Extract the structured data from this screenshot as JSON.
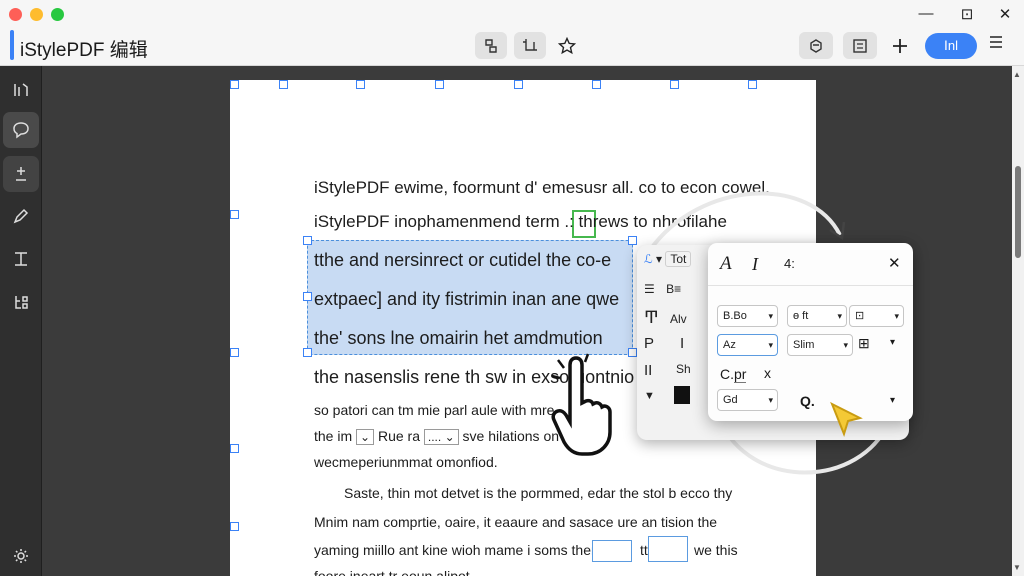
{
  "app": {
    "title": "iStylePDF 编辑"
  },
  "titlebar": {
    "window_controls": {
      "minimize": "—",
      "restore": "⊡",
      "close": "✕"
    },
    "center_buttons": [
      "page-layout-icon",
      "crop-icon",
      "star-icon"
    ],
    "right_buttons": [
      "plugin-icon",
      "page-grid-icon",
      "plus-icon"
    ],
    "primary_button": "Ⅰnl",
    "menu_icon": "☰"
  },
  "rail": {
    "items": [
      "panel-icon",
      "comment-icon",
      "stamp-icon",
      "pen-icon",
      "text-cursor-icon",
      "share-icon",
      "settings-icon"
    ]
  },
  "document": {
    "lines": [
      "iStylePDF ewime, foormunt d' emesusr all. co to econ cowel.",
      "iStylePDF inophamenmend term .: threws to nhrofilahe",
      "tthe and nersinrect or cutidel the co-e",
      "extpaec] and ity fistrimin inan ane qwe",
      "the' sons lne omairin het amdmution",
      "the nasenslis rene th sw in exsoruontnio",
      "so patori can tm mie parl aule with mre",
      "the im",
      "Rue ra",
      "....",
      "sve hilations on",
      "wecmeperiunmmat omonfiod.",
      "Saste, thin mot detvet is the pormmed, edar the stol b ecco thy",
      "Mnim nam comprtie, oaire, it eaaure and sasace ure an tision the",
      "yaming miillo ant kine wioh mame i soms there",
      "ttn",
      "we this",
      "foore ineart tr eoun alipot"
    ]
  },
  "floating_toolbar": {
    "left_column": {
      "style_dropdown": "Tot",
      "row2": "B≡",
      "row3": "Alv",
      "letters": [
        "P",
        "I",
        "II",
        "Sh"
      ]
    },
    "main": {
      "row1": [
        "A",
        "I",
        "4:"
      ],
      "close": "✕",
      "font_dropdown": "B.Bo",
      "size_dropdown": "ɵ ft",
      "format_dropdown": "⊡",
      "align_dropdown": "Az",
      "spacing_dropdown": "Slim",
      "color_label": "C.",
      "color_value": "pr",
      "clear_icon": "x",
      "bottom_dropdown": "Gd",
      "query_label": "Q."
    }
  }
}
